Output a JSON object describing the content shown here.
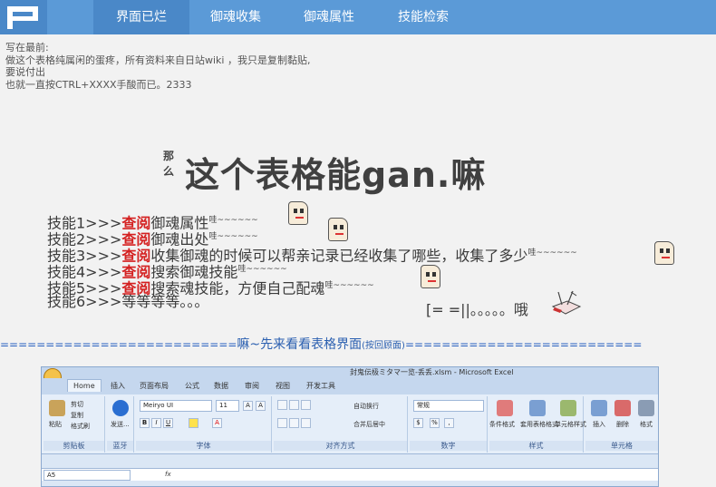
{
  "nav": {
    "items": [
      {
        "label": "界面已烂",
        "active": true
      },
      {
        "label": "御魂收集",
        "active": false
      },
      {
        "label": "御魂属性",
        "active": false
      },
      {
        "label": "技能检索",
        "active": false
      }
    ]
  },
  "preface": {
    "lines": [
      "写在最前:",
      "做这个表格纯属闲的蛋疼，所有资料来自日站wiki ，我只是复制黏贴,",
      "要说付出",
      "也就一直按CTRL+XXXX手酸而已。2333"
    ]
  },
  "headline": {
    "small": "那么",
    "big": "这个表格能gan.嘛"
  },
  "skills": [
    {
      "prefix": "技能1>>>",
      "view": "查阅",
      "text": "御魂属性",
      "sup": "哇~~~~~~"
    },
    {
      "prefix": "技能2>>>",
      "view": "查阅",
      "text": "御魂出处",
      "sup": "哇~~~~~~"
    },
    {
      "prefix": "技能3>>>",
      "view": "查阅",
      "text": "收集御魂的时候可以帮亲记录已经收集了哪些，收集了多少",
      "sup": "哇~~~~~~"
    },
    {
      "prefix": "技能4>>>",
      "view": "查阅",
      "text": "搜索御魂技能",
      "sup": "哇~~~~~~"
    },
    {
      "prefix": "技能5>>>",
      "view": "查阅",
      "text": "搜索魂技能，方便自己配魂",
      "sup": "哇~~~~~~"
    },
    {
      "prefix": "技能6>>>",
      "view": "",
      "text": "等等等等。。。",
      "sup": ""
    }
  ],
  "tail": "[= =||。。。。。哦",
  "divider": {
    "left": "==========================",
    "middle": "嘛~先来看看表格界面",
    "back": "(按回顾面)",
    "right": "=========================="
  },
  "excel": {
    "title": "封鬼伝极ミタマ一览-丢丢.xlsm - Microsoft Excel",
    "tabs": [
      "Home",
      "插入",
      "页面布局",
      "公式",
      "数据",
      "审阅",
      "视图",
      "开发工具"
    ],
    "clipboard": {
      "paste": "粘贴",
      "cut": "剪切",
      "copy": "复制",
      "format_painter": "格式刷",
      "group": "剪贴板"
    },
    "bluetooth": {
      "label": "发送...",
      "group": "蓝牙"
    },
    "font": {
      "name": "Meiryo UI",
      "size": "11",
      "group": "字体"
    },
    "alignment": {
      "wrap": "自动换行",
      "merge": "合并后居中",
      "group": "对齐方式"
    },
    "number": {
      "format": "常规",
      "group": "数字"
    },
    "styles": {
      "cond": "条件格式",
      "table": "套用表格格式",
      "cell": "单元格样式",
      "group": "样式"
    },
    "cells": {
      "insert": "插入",
      "delete": "删除",
      "format": "格式",
      "group": "单元格"
    },
    "name_box": "A5",
    "fx": "fx"
  }
}
